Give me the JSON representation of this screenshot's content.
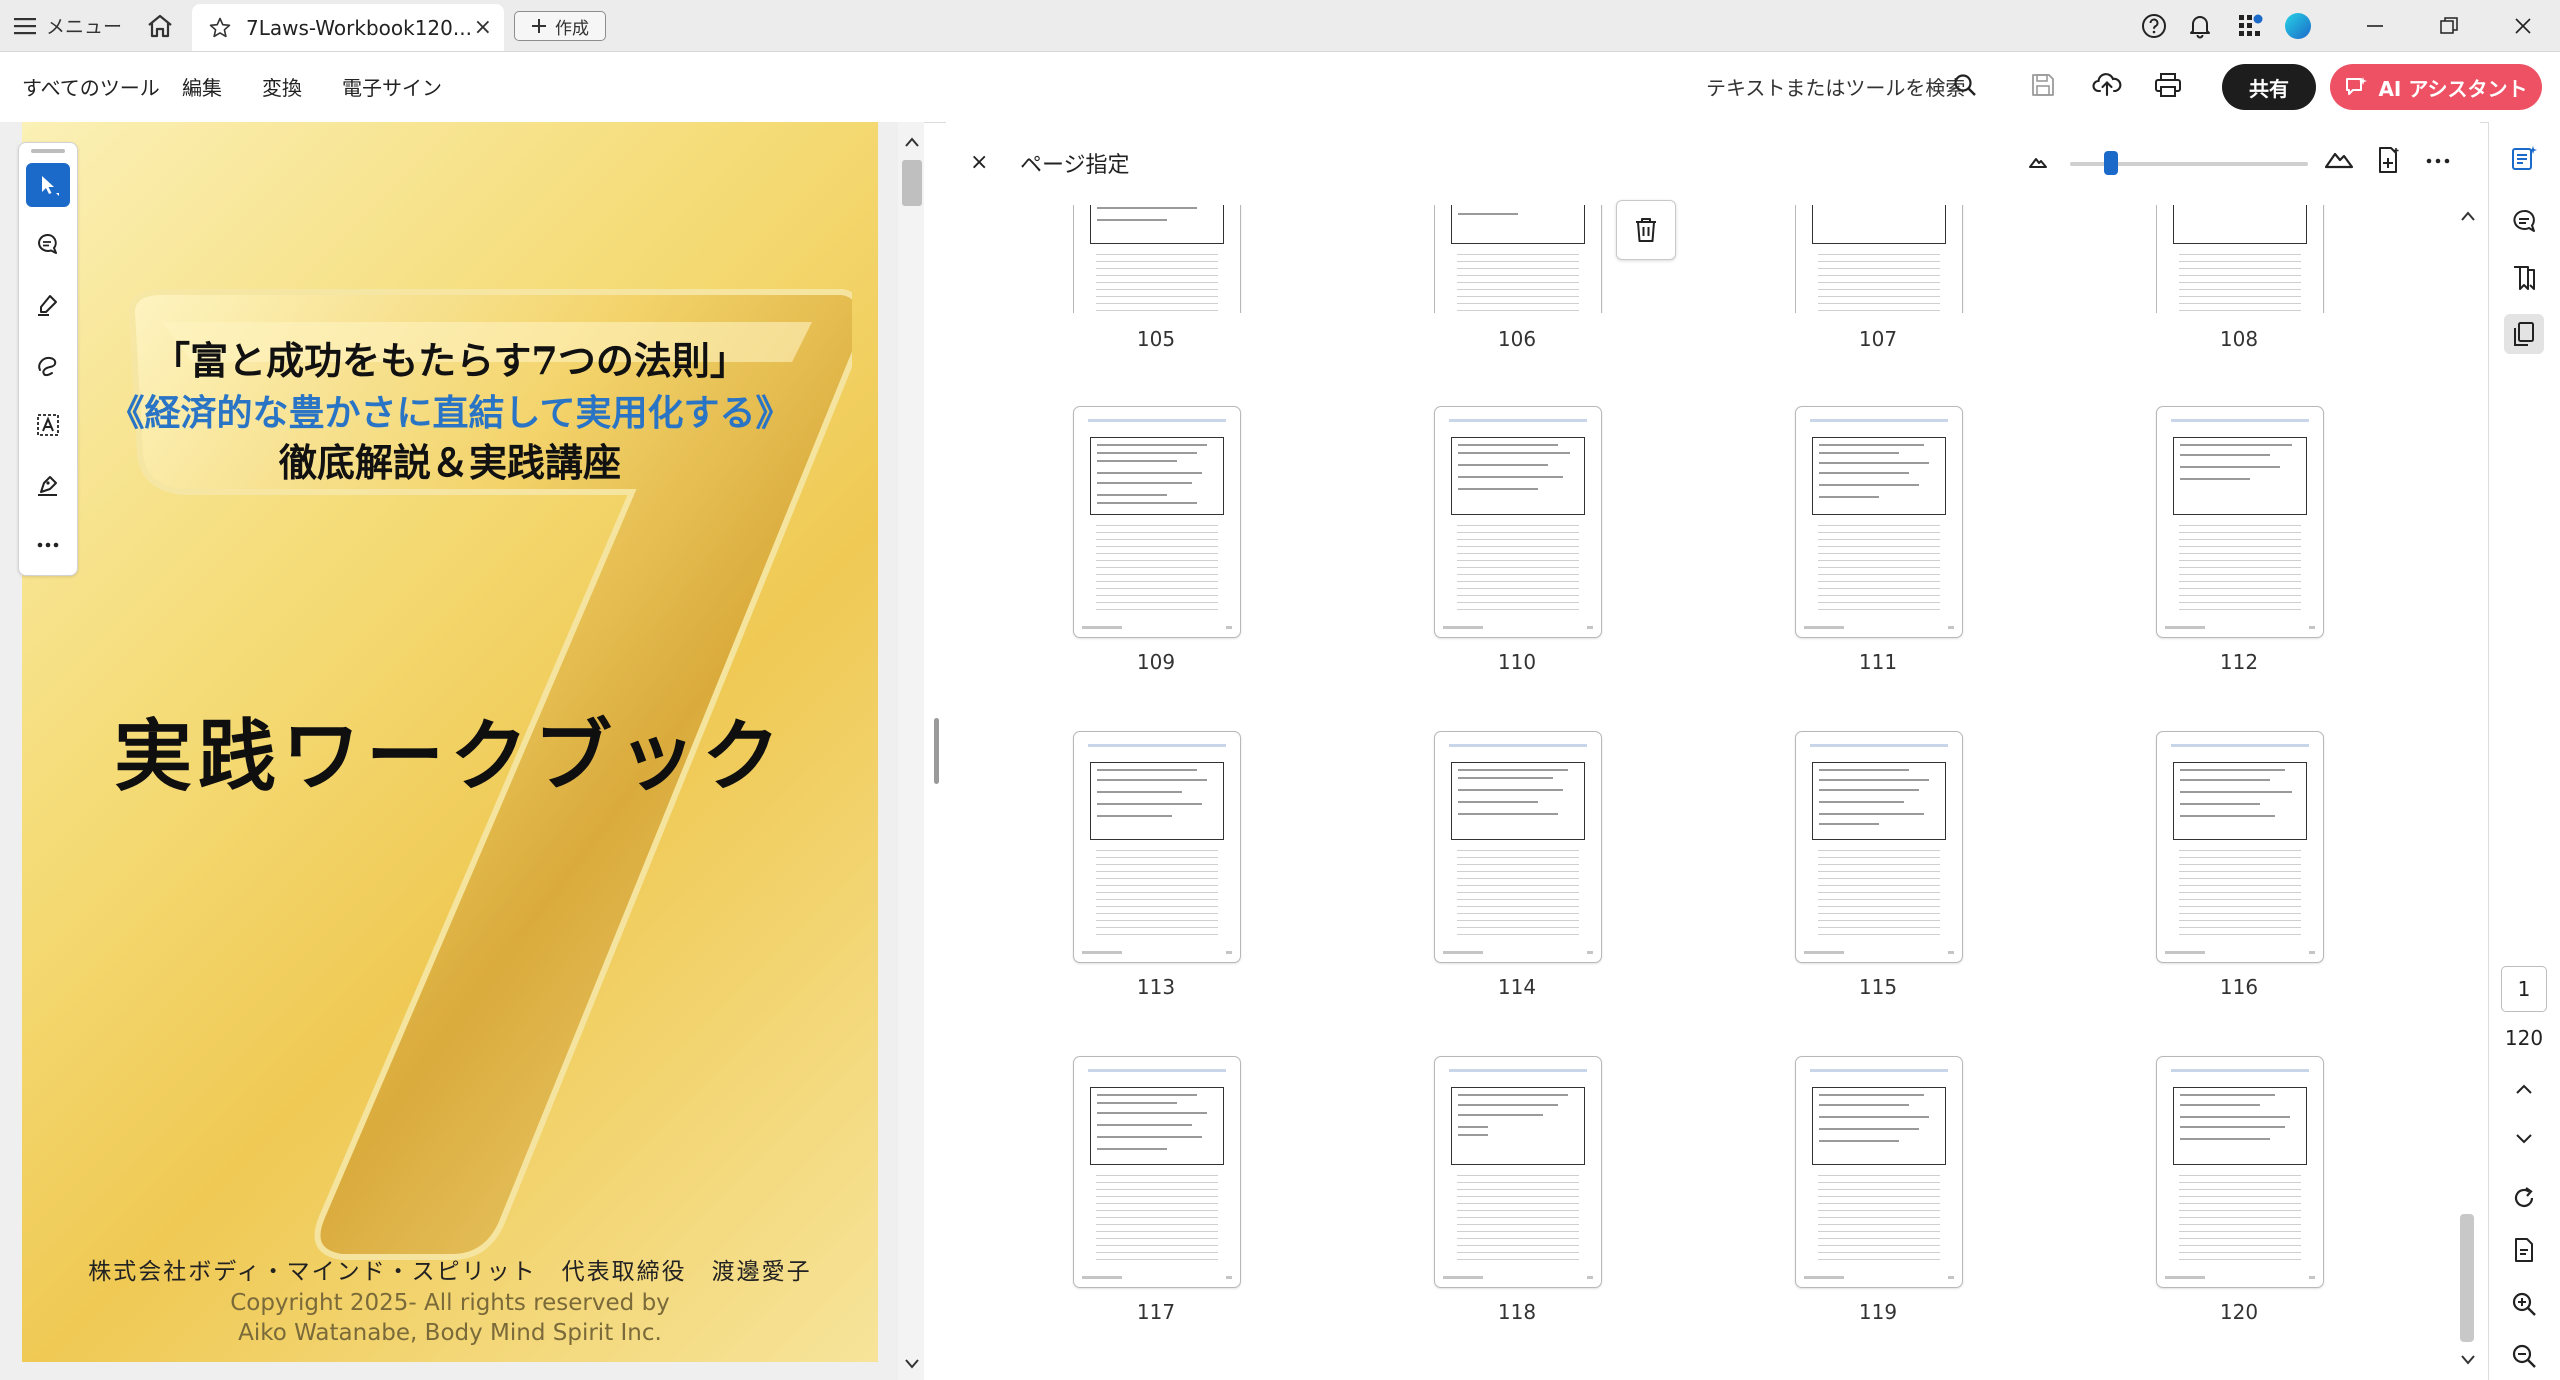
{
  "titlebar": {
    "menu_label": "メニュー",
    "tab_title": "7Laws-Workbook120...",
    "tab_close": "×",
    "create_label": "作成"
  },
  "menubar": {
    "items": [
      "すべてのツール",
      "編集",
      "変換",
      "電子サイン"
    ],
    "search_label": "テキストまたはツールを検索",
    "share_label": "共有",
    "ai_label": "AI アシスタント"
  },
  "cover": {
    "line1": "「富と成功をもたらす7つの法則」",
    "line2": "《経済的な豊かさに直結して実用化する》",
    "line3": "徹底解説＆実践講座",
    "line4": "実践ワークブック",
    "line5": "株式会社ボディ・マインド・スピリット　代表取締役　渡邊愛子",
    "line6": "Copyright 2025-  All rights reserved by",
    "line7": "Aiko Watanabe, Body Mind Spirit Inc."
  },
  "organizer": {
    "close_label": "×",
    "title": "ページ指定",
    "pages": [
      "105",
      "106",
      "107",
      "108",
      "109",
      "110",
      "111",
      "112",
      "113",
      "114",
      "115",
      "116",
      "117",
      "118",
      "119",
      "120"
    ]
  },
  "navigator": {
    "current_page": "1",
    "total_pages": "120"
  },
  "colors": {
    "accent": "#1b6ac9",
    "ai_button": "#ef5164",
    "share_button": "#1d1d1d",
    "cover_gold": "#efc954"
  }
}
